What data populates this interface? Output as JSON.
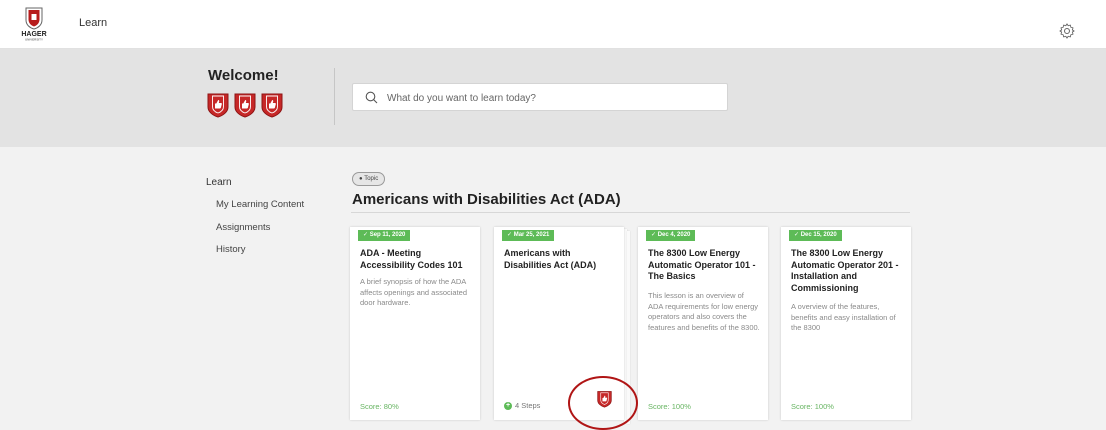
{
  "header": {
    "logo_text": "HAGER",
    "logo_subtext": "UNIVERSITY",
    "nav_learn": "Learn",
    "brand_color": "#b71c1c"
  },
  "hero": {
    "welcome": "Welcome!",
    "badge_count": 3,
    "search_placeholder": "What do you want to learn today?"
  },
  "sidebar": {
    "title": "Learn",
    "items": [
      {
        "label": "My Learning Content"
      },
      {
        "label": "Assignments"
      },
      {
        "label": "History"
      }
    ]
  },
  "content": {
    "topic_tag": "Topic",
    "title": "Americans with Disabilities Act (ADA)",
    "cards": [
      {
        "date": "✓ Sep 11, 2020",
        "title": "ADA - Meeting Accessibility Codes 101",
        "description": "A brief synopsis of how the ADA affects openings and associated door hardware.",
        "footer": "Score: 80%"
      },
      {
        "date": "✓ Mar 25, 2021",
        "title": "Americans with Disabilities Act (ADA)",
        "description": "",
        "footer": "4 Steps"
      },
      {
        "date": "✓ Dec 4, 2020",
        "title": "The 8300 Low Energy Automatic Operator 101 - The Basics",
        "description": "This lesson is an overview of ADA requirements for low energy operators and also covers the features and benefits of the 8300.",
        "footer": "Score: 100%"
      },
      {
        "date": "✓ Dec 15, 2020",
        "title": "The 8300 Low Energy Automatic Operator 201 - Installation and Commissioning",
        "description": "A overview of the features, benefits and easy installation of the 8300",
        "footer": "Score: 100%"
      }
    ]
  },
  "colors": {
    "badge_red": "#c62828",
    "success_green": "#5dbb57",
    "highlight": "#b01515"
  }
}
